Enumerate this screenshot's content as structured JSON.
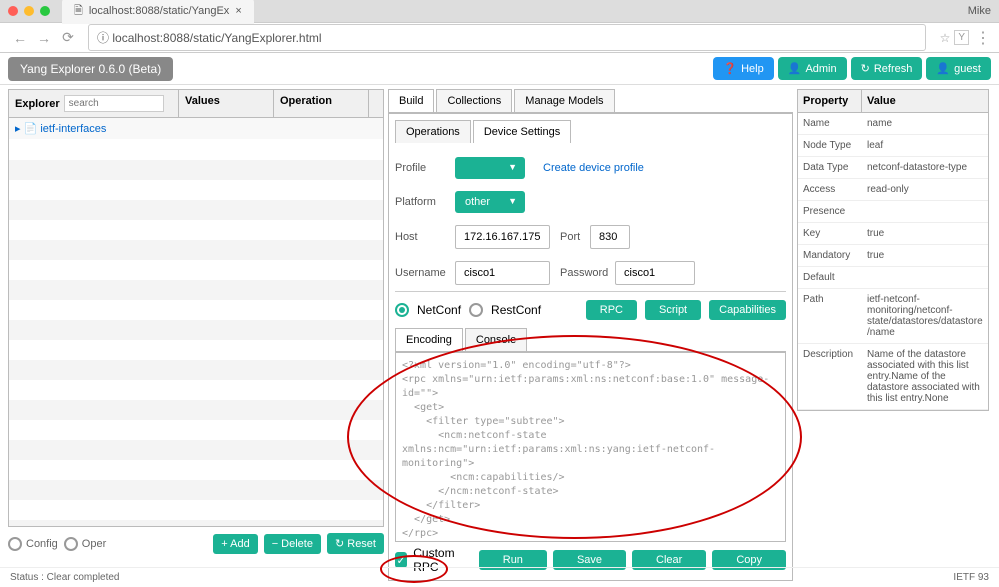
{
  "browser": {
    "tab_title": "localhost:8088/static/YangEx",
    "profile": "Mike",
    "url_display": "localhost:8088/static/YangExplorer.html"
  },
  "header": {
    "app_title": "Yang Explorer 0.6.0 (Beta)",
    "help": "Help",
    "admin": "Admin",
    "refresh": "Refresh",
    "guest": "guest"
  },
  "explorer": {
    "title": "Explorer",
    "search_placeholder": "search",
    "values_header": "Values",
    "operation_header": "Operation",
    "tree_item": "ietf-interfaces",
    "config": "Config",
    "oper": "Oper",
    "add": "Add",
    "delete": "Delete",
    "reset": "Reset"
  },
  "build": {
    "tabs": {
      "build": "Build",
      "collections": "Collections",
      "manage": "Manage Models"
    },
    "subtabs": {
      "operations": "Operations",
      "device": "Device Settings"
    },
    "profile_label": "Profile",
    "create_profile": "Create device profile",
    "platform_label": "Platform",
    "platform_value": "other",
    "host_label": "Host",
    "host_value": "172.16.167.175",
    "port_label": "Port",
    "port_value": "830",
    "username_label": "Username",
    "username_value": "cisco1",
    "password_label": "Password",
    "password_value": "cisco1",
    "netconf": "NetConf",
    "restconf": "RestConf",
    "rpc": "RPC",
    "script": "Script",
    "capabilities": "Capabilities",
    "encoding": "Encoding",
    "console": "Console",
    "rpc_body": "<?xml version=\"1.0\" encoding=\"utf-8\"?>\n<rpc xmlns=\"urn:ietf:params:xml:ns:netconf:base:1.0\" message-id=\"\">\n  <get>\n    <filter type=\"subtree\">\n      <ncm:netconf-state xmlns:ncm=\"urn:ietf:params:xml:ns:yang:ietf-netconf-monitoring\">\n        <ncm:capabilities/>\n      </ncm:netconf-state>\n    </filter>\n  </get>\n</rpc>",
    "custom_rpc": "Custom RPC",
    "run": "Run",
    "save": "Save",
    "clear": "Clear",
    "copy": "Copy"
  },
  "property": {
    "header_prop": "Property",
    "header_val": "Value",
    "rows": [
      {
        "k": "Name",
        "v": "name"
      },
      {
        "k": "Node Type",
        "v": "leaf"
      },
      {
        "k": "Data Type",
        "v": "netconf-datastore-type"
      },
      {
        "k": "Access",
        "v": "read-only"
      },
      {
        "k": "Presence",
        "v": ""
      },
      {
        "k": "Key",
        "v": "true"
      },
      {
        "k": "Mandatory",
        "v": "true"
      },
      {
        "k": "Default",
        "v": ""
      },
      {
        "k": "Path",
        "v": "ietf-netconf-monitoring/netconf-state/datastores/datastore/name"
      },
      {
        "k": "Description",
        "v": "Name of the datastore associated with this list entry.Name of the datastore associated with this list entry.None"
      }
    ]
  },
  "status": {
    "status_text": "Status : Clear completed",
    "right_text": "IETF 93"
  }
}
